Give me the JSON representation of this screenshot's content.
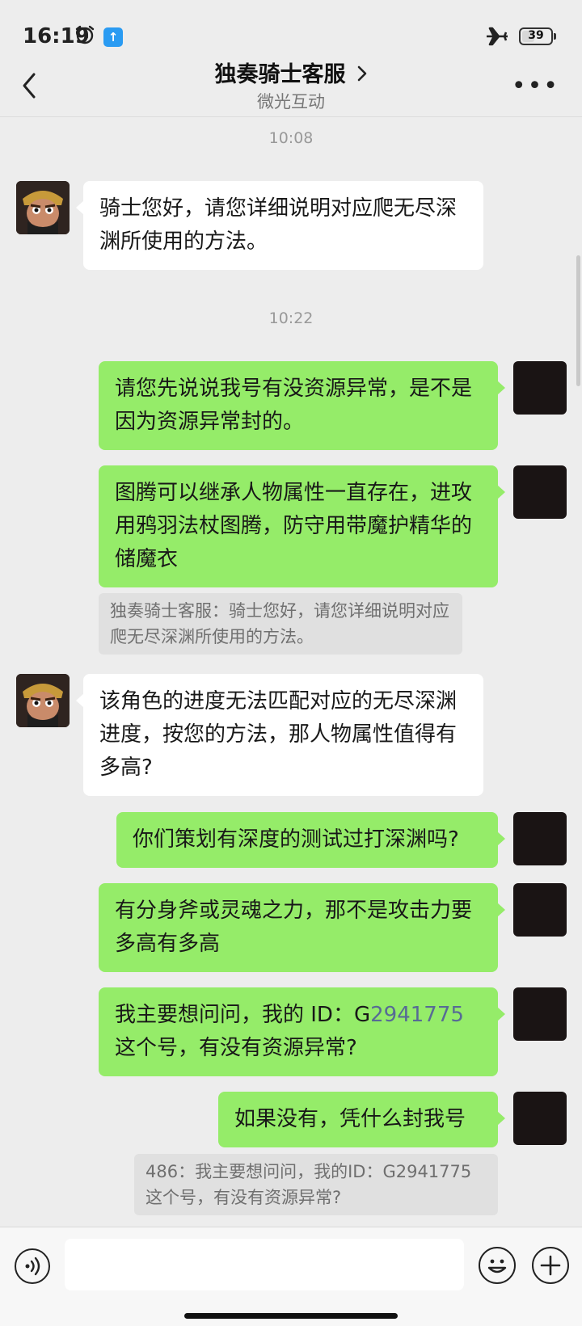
{
  "status_bar": {
    "time": "16:19",
    "battery": "39"
  },
  "header": {
    "title": "独奏骑士客服",
    "subtitle": "微光互动"
  },
  "messages": [
    {
      "type": "timestamp",
      "text": "10:08"
    },
    {
      "type": "in",
      "text": "骑士您好，请您详细说明对应爬无尽深渊所使用的方法。"
    },
    {
      "type": "timestamp",
      "text": "10:22"
    },
    {
      "type": "out",
      "text": "请您先说说我号有没资源异常，是不是因为资源异常封的。"
    },
    {
      "type": "out",
      "text": "图腾可以继承人物属性一直存在，进攻用鸦羽法杖图腾，防守用带魔护精华的储魔衣"
    },
    {
      "type": "quote",
      "text": "独奏骑士客服：骑士您好，请您详细说明对应爬无尽深渊所使用的方法。"
    },
    {
      "type": "in",
      "text": "该角色的进度无法匹配对应的无尽深渊进度，按您的方法，那人物属性值得有多高?"
    },
    {
      "type": "out",
      "text": "你们策划有深度的测试过打深渊吗?"
    },
    {
      "type": "out",
      "text": "有分身斧或灵魂之力，那不是攻击力要多高有多高"
    },
    {
      "type": "out",
      "text_prefix": "我主要想问问，我的 ID：G",
      "link": "2941775",
      "text_suffix": "这个号，有没有资源异常?"
    },
    {
      "type": "out",
      "text": "如果没有，凭什么封我号"
    },
    {
      "type": "quote",
      "text": "486：我主要想问问，我的ID：G2941775这个号，有没有资源异常?"
    }
  ]
}
